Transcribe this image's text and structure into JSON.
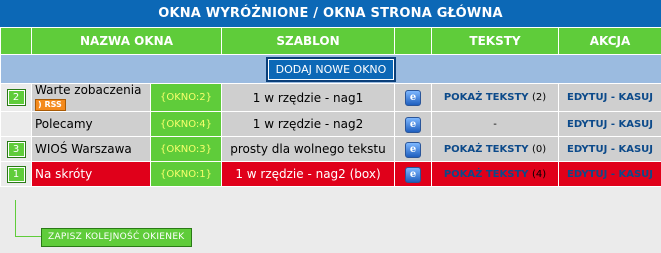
{
  "title": "OKNA WYRÓŻNIONE / OKNA STRONA GŁÓWNA",
  "headers": {
    "name": "NAZWA OKNA",
    "template": "SZABLON",
    "texts": "TEKSTY",
    "action": "AKCJA"
  },
  "add_button": "DODAJ NOWE OKNO",
  "rss_label": "RSS",
  "rows": [
    {
      "num": "2",
      "name": "Warte zobaczenia",
      "rss": true,
      "code": "{OKNO:2}",
      "template": "1 w rzędzie - nag1",
      "texts_link": "POKAŻ TEKSTY",
      "texts_count": "(2)",
      "texts_dash": "",
      "edit": "EDYTUJ",
      "sep": "-",
      "del": "KASUJ",
      "style": "gray"
    },
    {
      "num": "",
      "name": "Polecamy",
      "rss": false,
      "code": "{OKNO:4}",
      "template": "1 w rzędzie - nag2",
      "texts_link": "",
      "texts_count": "",
      "texts_dash": "-",
      "edit": "EDYTUJ",
      "sep": "-",
      "del": "KASUJ",
      "style": "gray"
    },
    {
      "num": "3",
      "name": "WIOŚ Warszawa",
      "rss": false,
      "code": "{OKNO:3}",
      "template": "prosty dla wolnego tekstu",
      "texts_link": "POKAŻ TEKSTY",
      "texts_count": "(0)",
      "texts_dash": "",
      "edit": "EDYTUJ",
      "sep": "-",
      "del": "KASUJ",
      "style": "gray"
    },
    {
      "num": "1",
      "name": "Na skróty",
      "rss": false,
      "code": "{OKNO:1}",
      "template": "1 w rzędzie - nag2 (box)",
      "texts_link": "POKAŻ TEKSTY",
      "texts_count": "(4)",
      "texts_dash": "",
      "edit": "EDYTUJ",
      "sep": "-",
      "del": "KASUJ",
      "style": "red"
    }
  ],
  "save_order": "ZAPISZ KOLEJNOŚĆ OKIENEK",
  "colors": {
    "accent_blue": "#0c68b6",
    "accent_green": "#5fcc3a",
    "highlight_red": "#e0001a"
  },
  "icons": {
    "preview": "ie-browser-icon",
    "rss": "rss-badge-icon"
  }
}
